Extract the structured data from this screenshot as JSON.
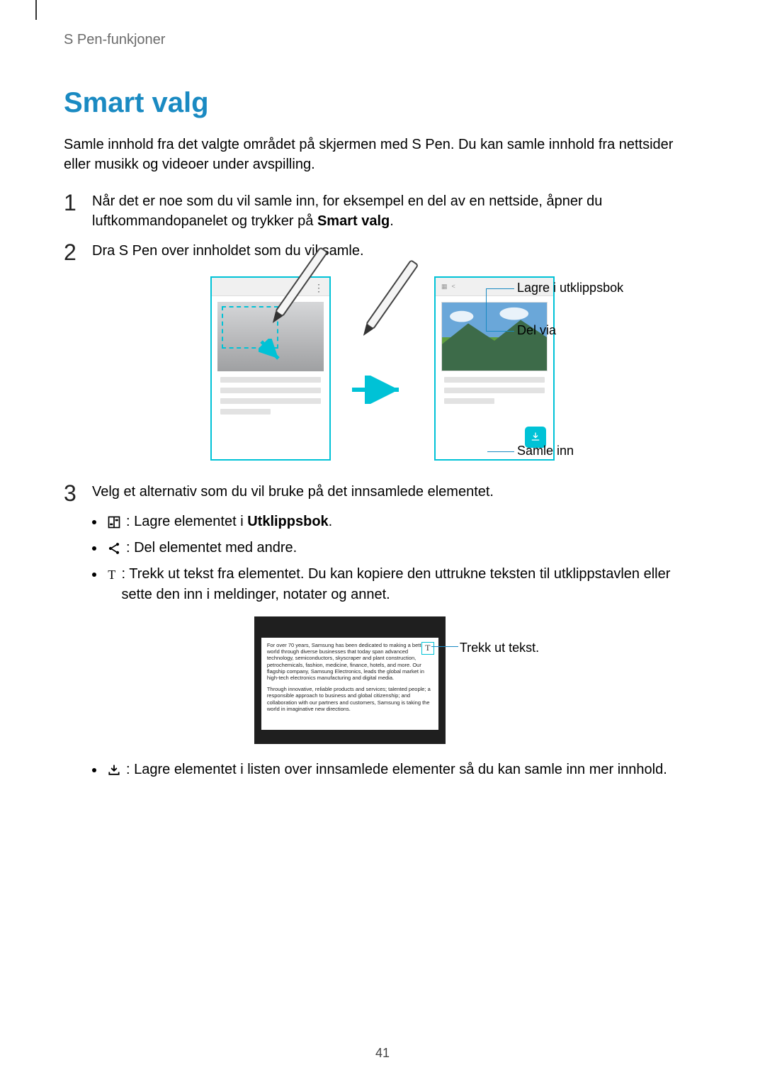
{
  "header": {
    "breadcrumb": "S Pen-funkjoner"
  },
  "title": "Smart valg",
  "intro": "Samle innhold fra det valgte området på skjermen med S Pen. Du kan samle innhold fra nettsider eller musikk og videoer under avspilling.",
  "steps": {
    "s1": {
      "num": "1",
      "text_a": "Når det er noe som du vil samle inn, for eksempel en del av en nettside, åpner du luftkommandopanelet og trykker på ",
      "bold": "Smart valg",
      "text_b": "."
    },
    "s2": {
      "num": "2",
      "text": "Dra S Pen over innholdet som du vil samle."
    },
    "s3": {
      "num": "3",
      "text": "Velg et alternativ som du vil bruke på det innsamlede elementet."
    }
  },
  "figure1": {
    "callouts": {
      "save": "Lagre i utklippsbok",
      "share": "Del via",
      "collect": "Samle inn"
    }
  },
  "bullets": {
    "b1_a": ": Lagre elementet i ",
    "b1_bold": "Utklippsbok",
    "b1_b": ".",
    "b2": ": Del elementet med andre.",
    "b3": ": Trekk ut tekst fra elementet. Du kan kopiere den uttrukne teksten til utklippstavlen eller sette den inn i meldinger, notater og annet.",
    "b4": ": Lagre elementet i listen over innsamlede elementer så du kan samle inn mer innhold."
  },
  "figure2": {
    "sample_text_p1": "For over 70 years, Samsung has been dedicated to making a better world through diverse businesses that today span advanced technology, semiconductors, skyscraper and plant construction, petrochemicals, fashion, medicine, finance, hotels, and more. Our flagship company, Samsung Electronics, leads the global market in high-tech electronics manufacturing and digital media.",
    "sample_text_p2": "Through innovative, reliable products and services; talented people; a responsible approach to business and global citizenship; and collaboration with our partners and customers, Samsung is taking the world in imaginative new directions.",
    "t_button": "T",
    "callout": "Trekk ut tekst."
  },
  "page_number": "41"
}
